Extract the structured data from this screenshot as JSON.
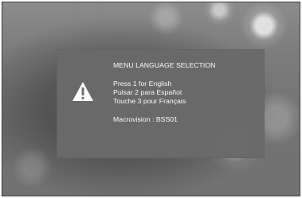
{
  "dialog": {
    "title": "MENU LANGUAGE SELECTION",
    "options": [
      "Press 1 for English",
      "Pulsar 2 para Español",
      "Touche 3 pour Français"
    ],
    "footer": "Macrovision : BSS01"
  },
  "icons": {
    "warning": "warning-icon"
  }
}
